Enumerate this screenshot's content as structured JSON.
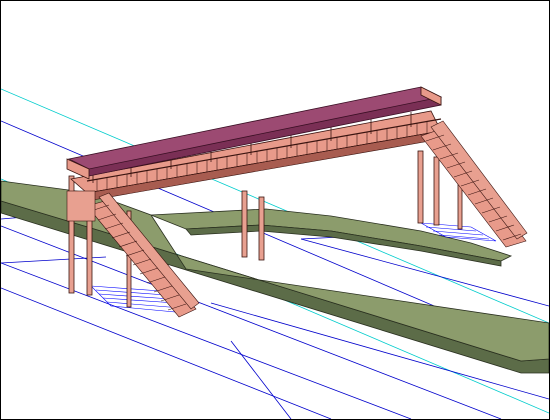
{
  "viewport": {
    "background": "#ffffff",
    "border_color": "#000000"
  },
  "scene": {
    "subject": "footbridge",
    "colors": {
      "roof_top": "#9c4a72",
      "roof_side": "#7a2f55",
      "roof_edge": "#3a0f24",
      "structure": "#e89a8a",
      "structure_dark": "#a85c50",
      "outline": "#3a1410",
      "platform_top": "#8c9c6c",
      "platform_side": "#5c6c48",
      "platform_edge": "#2a3020",
      "grid_blue": "#0000cc",
      "grid_cyan": "#00cccc",
      "hatch_blue": "#0000ff",
      "column": "#e8a090"
    }
  }
}
